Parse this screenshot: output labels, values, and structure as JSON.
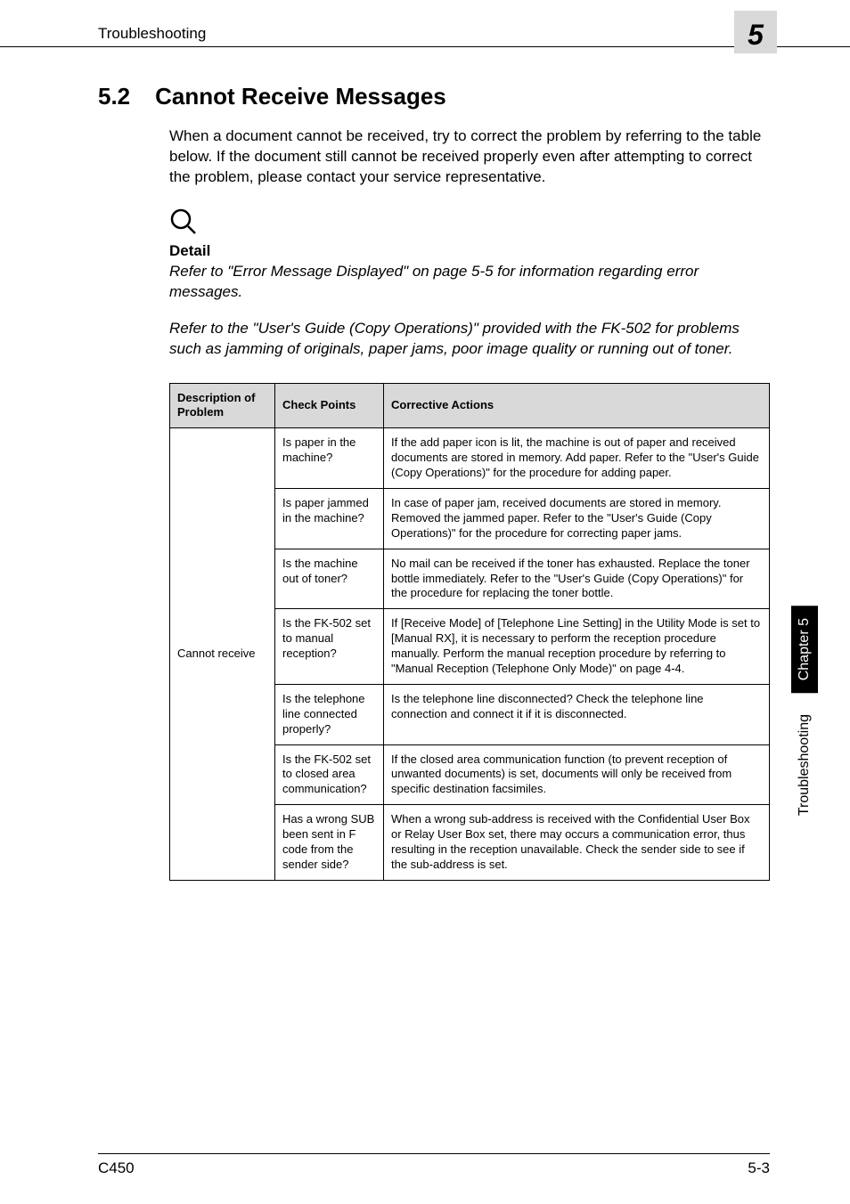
{
  "header": {
    "title": "Troubleshooting"
  },
  "chapter_tab": "5",
  "section": {
    "num": "5.2",
    "title": "Cannot Receive Messages"
  },
  "intro": "When a document cannot be received, try to correct the problem by referring to the table below. If the document still cannot be received properly even after attempting to correct the problem, please contact your service representative.",
  "detail": {
    "heading": "Detail",
    "p1": "Refer to \"Error Message Displayed\" on page 5-5 for information regarding error messages.",
    "p2": "Refer to the \"User's Guide (Copy Operations)\" provided with the FK-502 for problems such as jamming of originals, paper jams, poor image quality or running out of toner."
  },
  "table": {
    "headers": {
      "col1": "Description of Problem",
      "col2": "Check Points",
      "col3": "Corrective Actions"
    },
    "problem": "Cannot receive",
    "rows": [
      {
        "check": "Is paper in the machine?",
        "action": "If the add paper icon is lit, the machine is out of paper and received documents are stored in memory. Add paper. Refer to the \"User's Guide (Copy Operations)\" for the procedure for adding paper."
      },
      {
        "check": "Is paper jammed in the machine?",
        "action": "In case of paper jam, received documents are stored in memory. Removed the jammed paper. Refer to the \"User's Guide (Copy Operations)\" for the procedure for correcting paper jams."
      },
      {
        "check": "Is the machine out of toner?",
        "action": "No mail can be received if the toner has exhausted. Replace the toner bottle immediately. Refer to the \"User's Guide (Copy Operations)\" for the procedure for replacing the toner bottle."
      },
      {
        "check": "Is the FK-502 set to manual reception?",
        "action": "If [Receive Mode] of [Telephone Line Setting] in the Utility Mode is set to [Manual RX], it is necessary to perform the reception procedure manually. Perform the manual reception procedure by referring to \"Manual Reception (Telephone Only Mode)\" on page 4-4."
      },
      {
        "check": "Is the telephone line connected properly?",
        "action": "Is the telephone line disconnected? Check the telephone line connection and connect it if it is disconnected."
      },
      {
        "check": "Is the FK-502 set to closed area communication?",
        "action": "If the closed area communication function (to prevent reception of unwanted documents) is set, documents will only be received from specific destination facsimiles."
      },
      {
        "check": "Has a wrong SUB been sent in F code from the sender side?",
        "action": "When a wrong sub-address is received with the Confidential User Box or Relay User Box set, there may occurs a communication error, thus resulting in the reception unavailable. Check the sender side to see if the sub-address is set."
      }
    ]
  },
  "side": {
    "chapter": "Chapter 5",
    "section": "Troubleshooting"
  },
  "footer": {
    "left": "C450",
    "right": "5-3"
  }
}
